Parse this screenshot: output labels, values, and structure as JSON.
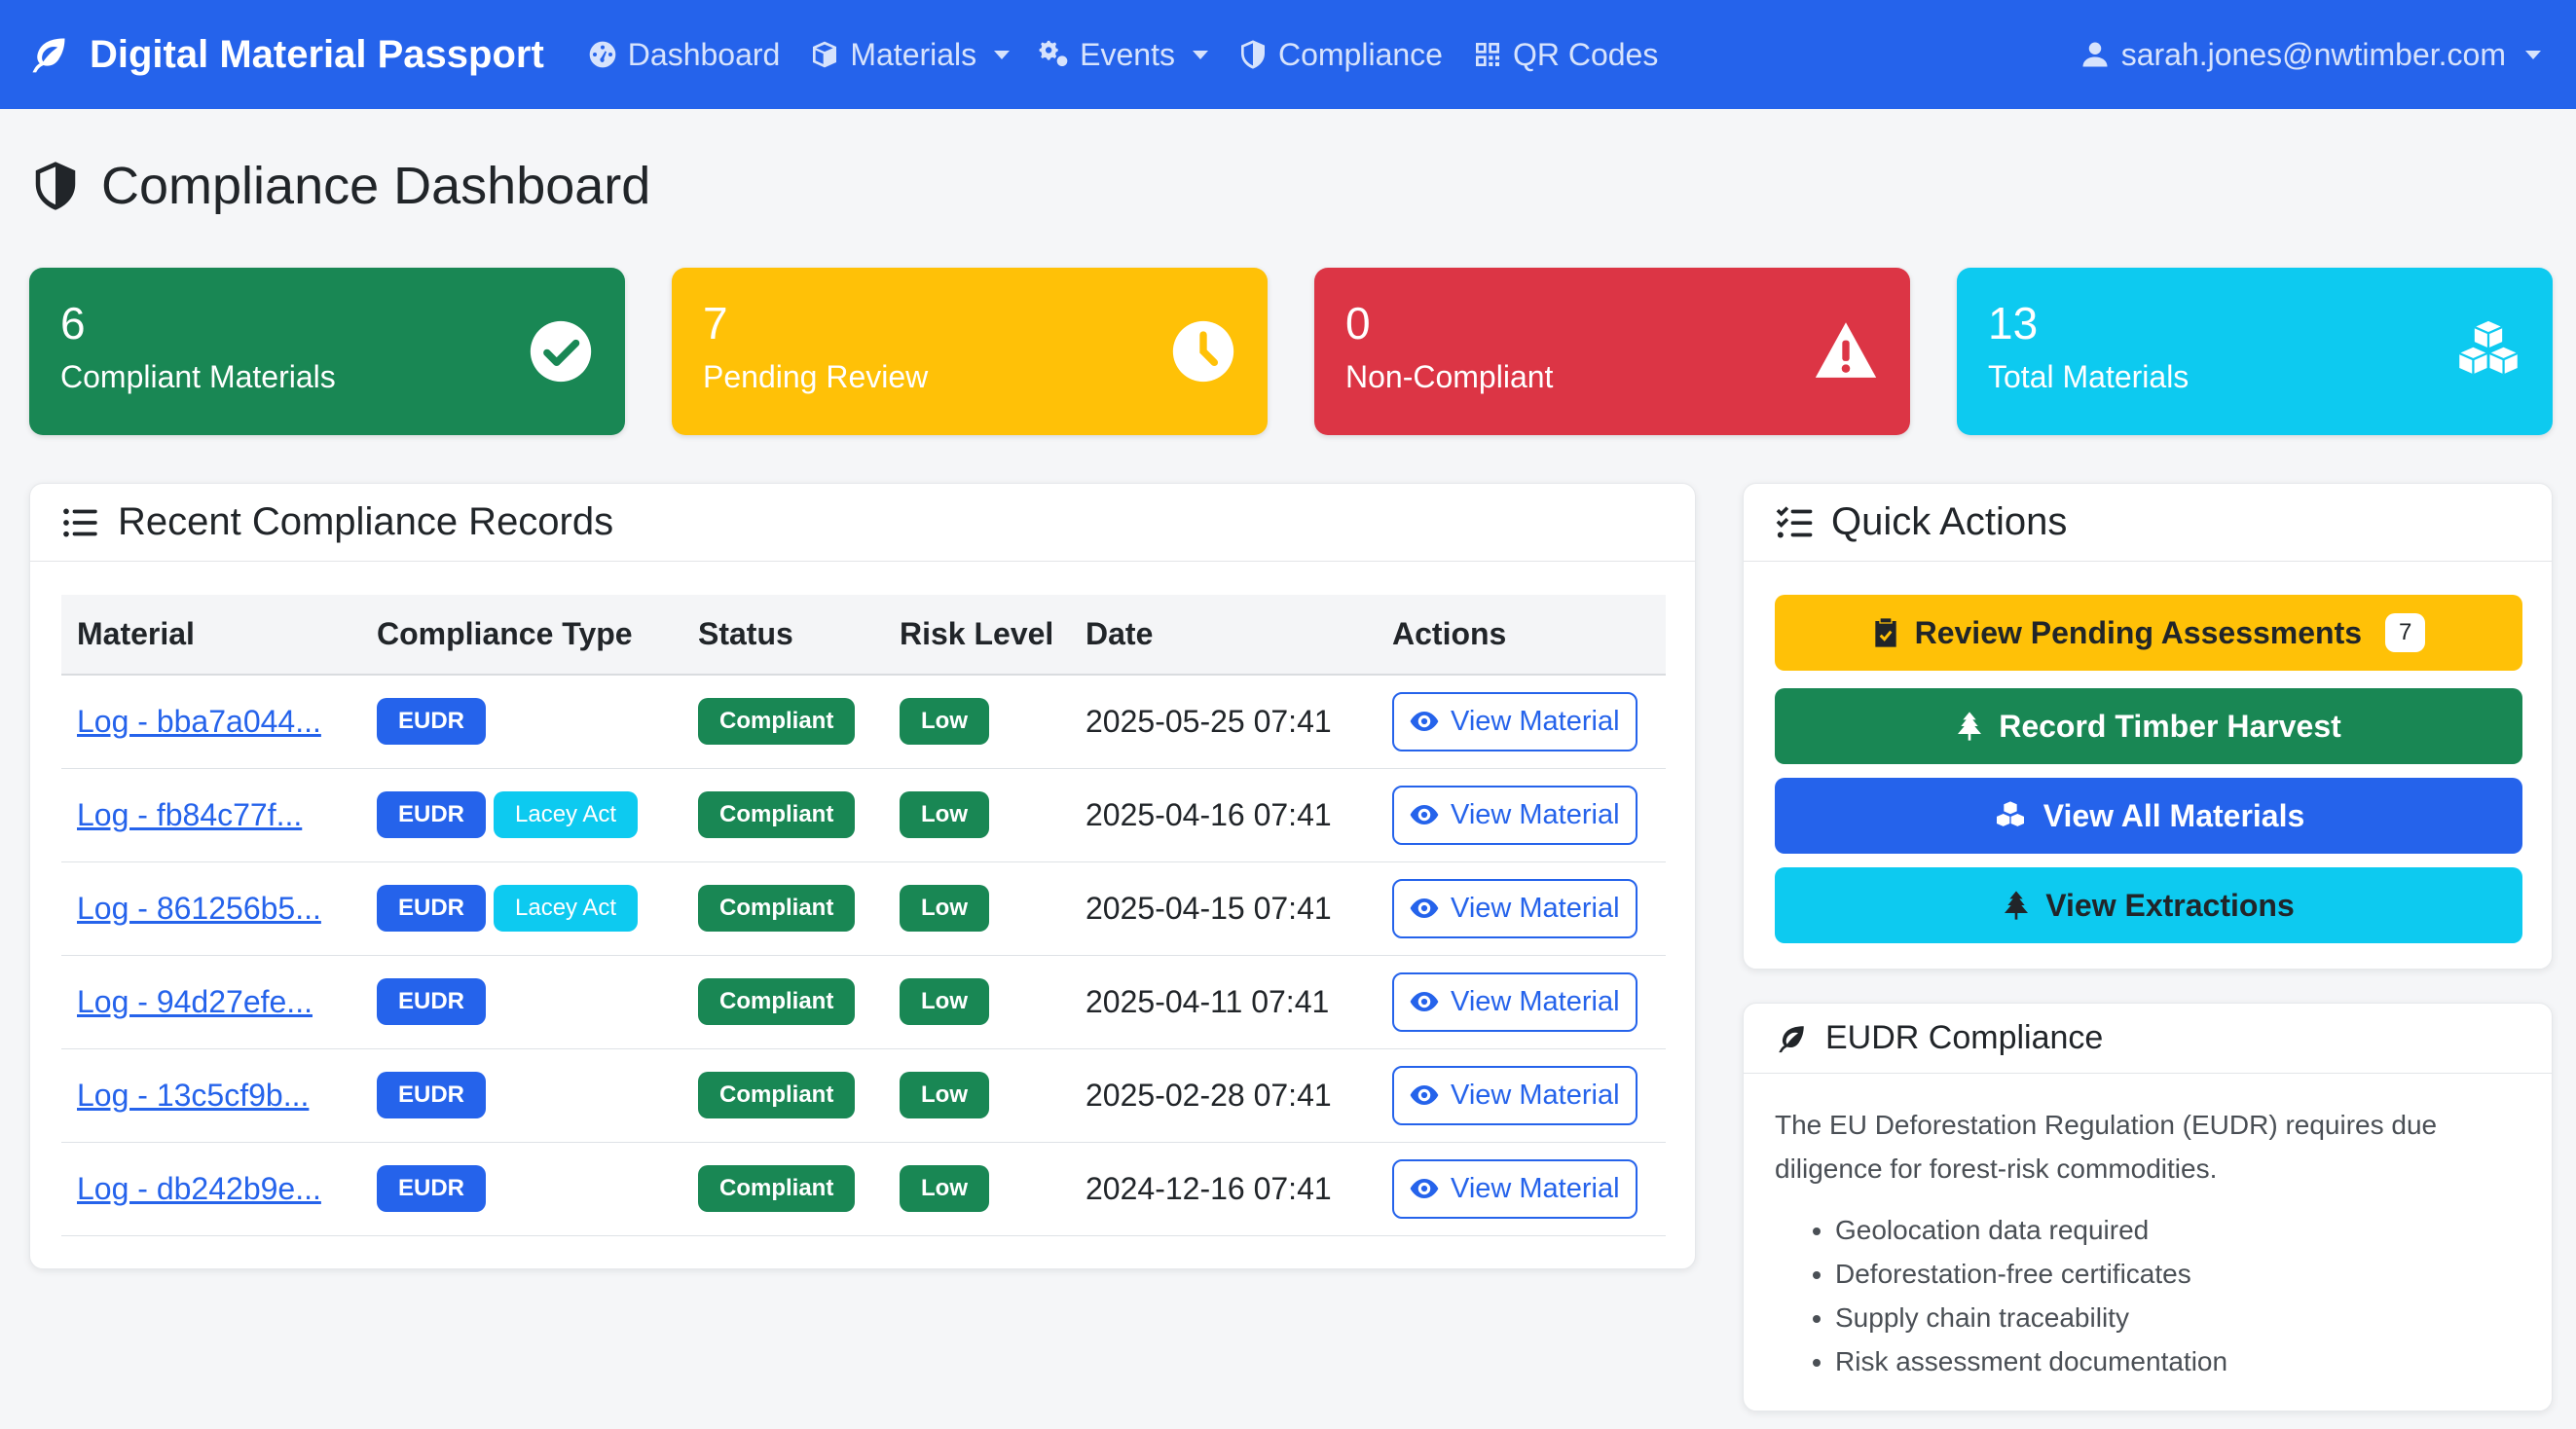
{
  "navbar": {
    "brand": "Digital Material Passport",
    "items": [
      {
        "label": "Dashboard"
      },
      {
        "label": "Materials"
      },
      {
        "label": "Events"
      },
      {
        "label": "Compliance"
      },
      {
        "label": "QR Codes"
      }
    ],
    "user": "sarah.jones@nwtimber.com"
  },
  "page": {
    "title": "Compliance Dashboard"
  },
  "stats": [
    {
      "value": "6",
      "label": "Compliant Materials",
      "color": "#198754"
    },
    {
      "value": "7",
      "label": "Pending Review",
      "color": "#ffc107"
    },
    {
      "value": "0",
      "label": "Non-Compliant",
      "color": "#dc3545"
    },
    {
      "value": "13",
      "label": "Total Materials",
      "color": "#0dcaf0"
    }
  ],
  "records": {
    "title": "Recent Compliance Records",
    "columns": [
      "Material",
      "Compliance Type",
      "Status",
      "Risk Level",
      "Date",
      "Actions"
    ],
    "rows": [
      {
        "material": "Log - bba7a044...",
        "types": [
          "EUDR"
        ],
        "status": "Compliant",
        "risk": "Low",
        "date": "2025-05-25 07:41",
        "action": "View Material"
      },
      {
        "material": "Log - fb84c77f...",
        "types": [
          "EUDR",
          "Lacey Act"
        ],
        "status": "Compliant",
        "risk": "Low",
        "date": "2025-04-16 07:41",
        "action": "View Material"
      },
      {
        "material": "Log - 861256b5...",
        "types": [
          "EUDR",
          "Lacey Act"
        ],
        "status": "Compliant",
        "risk": "Low",
        "date": "2025-04-15 07:41",
        "action": "View Material"
      },
      {
        "material": "Log - 94d27efe...",
        "types": [
          "EUDR"
        ],
        "status": "Compliant",
        "risk": "Low",
        "date": "2025-04-11 07:41",
        "action": "View Material"
      },
      {
        "material": "Log - 13c5cf9b...",
        "types": [
          "EUDR"
        ],
        "status": "Compliant",
        "risk": "Low",
        "date": "2025-02-28 07:41",
        "action": "View Material"
      },
      {
        "material": "Log - db242b9e...",
        "types": [
          "EUDR"
        ],
        "status": "Compliant",
        "risk": "Low",
        "date": "2024-12-16 07:41",
        "action": "View Material"
      }
    ]
  },
  "quick_actions": {
    "title": "Quick Actions",
    "review": {
      "label": "Review Pending Assessments",
      "count": "7"
    },
    "harvest": {
      "label": "Record Timber Harvest"
    },
    "view_all": {
      "label": "View All Materials"
    },
    "extractions": {
      "label": "View Extractions"
    }
  },
  "eudr": {
    "title": "EUDR Compliance",
    "text": "The EU Deforestation Regulation (EUDR) requires due diligence for forest-risk commodities.",
    "items": [
      "Geolocation data required",
      "Deforestation-free certificates",
      "Supply chain traceability",
      "Risk assessment documentation"
    ]
  }
}
